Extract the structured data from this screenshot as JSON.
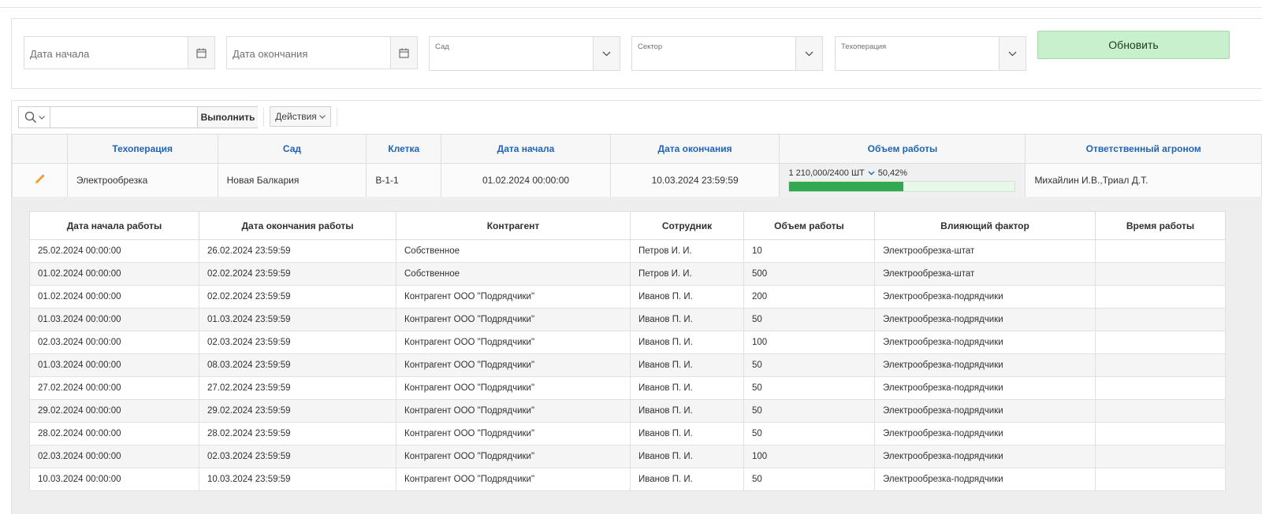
{
  "filters": {
    "start_date_placeholder": "Дата начала",
    "end_date_placeholder": "Дата окончания",
    "garden_label": "Сад",
    "sector_label": "Сектор",
    "techop_label": "Техоперация",
    "refresh_label": "Обновить",
    "accent": "#c9f0cc"
  },
  "toolbar": {
    "search_value": "",
    "go_label": "Выполнить",
    "actions_label": "Действия"
  },
  "main_table": {
    "headers": [
      "Техоперация",
      "Сад",
      "Клетка",
      "Дата начала",
      "Дата окончания",
      "Объем работы",
      "Ответственный агроном"
    ],
    "row": {
      "techop": "Электрообрезка",
      "garden": "Новая Балкария",
      "cell": "В-1-1",
      "start": "01.02.2024 00:00:00",
      "end": "10.03.2024 23:59:59",
      "volume_text": "1 210,000/2400 ШТ",
      "volume_percent_text": "50,42%",
      "volume_percent": 50.42,
      "agronomist": "Михайлин И.В.,Триал Д.Т."
    },
    "header_color": "#1f64b5",
    "progress_color": "#33a853"
  },
  "detail_table": {
    "headers": [
      "Дата начала работы",
      "Дата окончания работы",
      "Контрагент",
      "Сотрудник",
      "Объем работы",
      "Влияющий фактор",
      "Время работы"
    ],
    "rows": [
      [
        "25.02.2024 00:00:00",
        "26.02.2024 23:59:59",
        "Собственное",
        "Петров И. И.",
        "10",
        "Электрообрезка-штат",
        ""
      ],
      [
        "01.02.2024 00:00:00",
        "02.02.2024 23:59:59",
        "Собственное",
        "Петров И. И.",
        "500",
        "Электрообрезка-штат",
        ""
      ],
      [
        "01.02.2024 00:00:00",
        "02.02.2024 23:59:59",
        "Контрагент ООО \"Подрядчики\"",
        "Иванов П. И.",
        "200",
        "Электрообрезка-подрядчики",
        ""
      ],
      [
        "01.03.2024 00:00:00",
        "01.03.2024 23:59:59",
        "Контрагент ООО \"Подрядчики\"",
        "Иванов П. И.",
        "50",
        "Электрообрезка-подрядчики",
        ""
      ],
      [
        "02.03.2024 00:00:00",
        "02.03.2024 23:59:59",
        "Контрагент ООО \"Подрядчики\"",
        "Иванов П. И.",
        "100",
        "Электрообрезка-подрядчики",
        ""
      ],
      [
        "01.03.2024 00:00:00",
        "08.03.2024 23:59:59",
        "Контрагент ООО \"Подрядчики\"",
        "Иванов П. И.",
        "50",
        "Электрообрезка-подрядчики",
        ""
      ],
      [
        "27.02.2024 00:00:00",
        "27.02.2024 23:59:59",
        "Контрагент ООО \"Подрядчики\"",
        "Иванов П. И.",
        "50",
        "Электрообрезка-подрядчики",
        ""
      ],
      [
        "29.02.2024 00:00:00",
        "29.02.2024 23:59:59",
        "Контрагент ООО \"Подрядчики\"",
        "Иванов П. И.",
        "50",
        "Электрообрезка-подрядчики",
        ""
      ],
      [
        "28.02.2024 00:00:00",
        "28.02.2024 23:59:59",
        "Контрагент ООО \"Подрядчики\"",
        "Иванов П. И.",
        "50",
        "Электрообрезка-подрядчики",
        ""
      ],
      [
        "02.03.2024 00:00:00",
        "02.03.2024 23:59:59",
        "Контрагент ООО \"Подрядчики\"",
        "Иванов П. И.",
        "100",
        "Электрообрезка-подрядчики",
        ""
      ],
      [
        "10.03.2024 00:00:00",
        "10.03.2024 23:59:59",
        "Контрагент ООО \"Подрядчики\"",
        "Иванов П. И.",
        "50",
        "Электрообрезка-подрядчики",
        ""
      ]
    ]
  }
}
